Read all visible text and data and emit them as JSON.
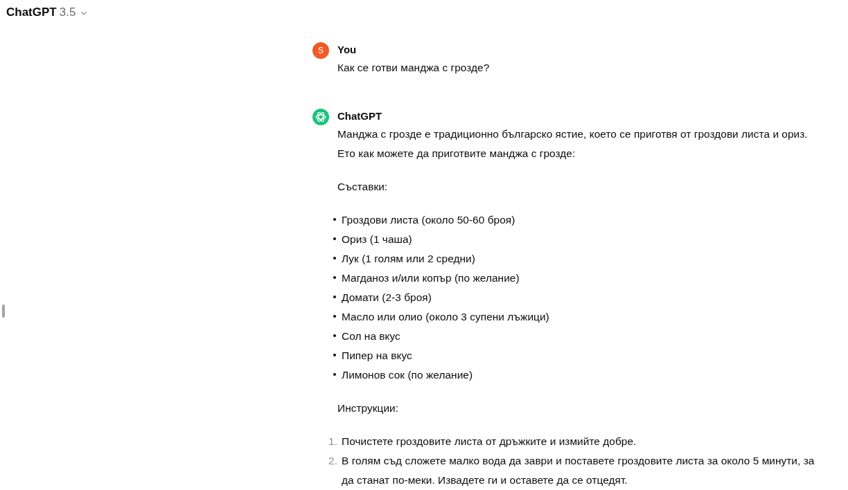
{
  "header": {
    "title": "ChatGPT",
    "version": "3.5"
  },
  "messages": [
    {
      "kind": "user",
      "author": "You",
      "avatar_letter": "S",
      "blocks": [
        {
          "kind": "paragraph",
          "text": "Как се готви манджа с грозде?"
        }
      ]
    },
    {
      "kind": "assistant",
      "author": "ChatGPT",
      "blocks": [
        {
          "kind": "paragraph",
          "text": "Манджа с грозде е традиционно българско ястие, което се приготвя от гроздови листа и ориз. Ето как можете да приготвите манджа с грозде:"
        },
        {
          "kind": "paragraph",
          "text": "Съставки:"
        },
        {
          "kind": "bullets",
          "items": [
            {
              "text": "Гроздови листа (около 50-60 броя)"
            },
            {
              "text": "Ориз (1 чаша)"
            },
            {
              "text": "Лук (1 голям или 2 средни)"
            },
            {
              "text": "Магданоз и/или копър (по желание)"
            },
            {
              "text": "Домати (2-3 броя)"
            },
            {
              "text": "Масло или олио (около 3 супени лъжици)"
            },
            {
              "text": "Сол на вкус"
            },
            {
              "text": "Пипер на вкус"
            },
            {
              "text": "Лимонов сок (по желание)"
            }
          ]
        },
        {
          "kind": "paragraph",
          "text": "Инструкции:"
        },
        {
          "kind": "numbered",
          "items": [
            {
              "number": "1.",
              "text": "Почистете гроздовите листа от дръжките и измийте добре."
            },
            {
              "number": "2.",
              "text": "В голям съд сложете малко вода да заври и поставете гроздовите листа за около 5 минути, за да станат по-меки. Извадете ги и оставете да се отцедят."
            }
          ]
        }
      ]
    }
  ]
}
